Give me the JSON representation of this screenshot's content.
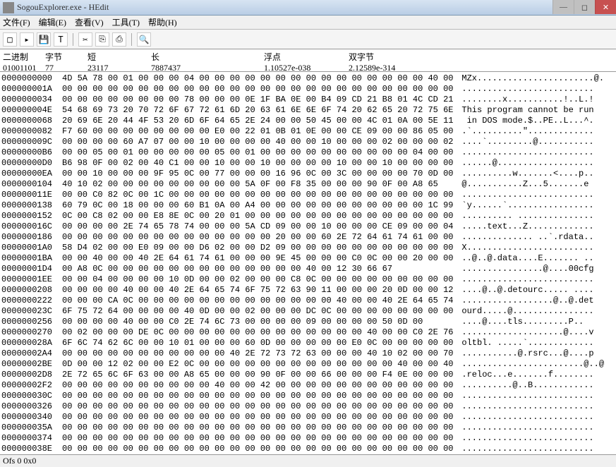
{
  "title": "SogouExplorer.exe - HEdit",
  "menu": {
    "file": "文件(F)",
    "edit": "编辑(E)",
    "view": "查看(V)",
    "tools": "工具(T)",
    "help": "帮助(H)"
  },
  "toolbar": {
    "new": "□",
    "open": "▸",
    "save": "💾",
    "text": "T",
    "cut": "✂",
    "copy": "⎘",
    "paste": "⎙",
    "find": "🔍"
  },
  "info": {
    "binary_label": "二进制",
    "binary_val": "01001101",
    "byte_label": "字节",
    "byte_val": "77",
    "short_label": "短",
    "short_val": "23117",
    "long_label": "长",
    "long_val": "7887437",
    "float_label": "浮点",
    "float_val": "1.10527e-038",
    "double_label": "双字节",
    "double_val": "2.12589e-314"
  },
  "status": "Ofs 0  0x0",
  "rows": [
    {
      "o": "0000000000",
      "h": "4D 5A 78 00 01 00 00 00 04 00 00 00 00 00 00 00 00 00 00 00 00 00 00 00 40 00",
      "a": "MZx.......................@."
    },
    {
      "o": "000000001A",
      "h": "00 00 00 00 00 00 00 00 00 00 00 00 00 00 00 00 00 00 00 00 00 00 00 00 00 00",
      "a": ".........................."
    },
    {
      "o": "0000000034",
      "h": "00 00 00 00 00 00 00 00 78 00 00 00 0E 1F BA 0E 00 B4 09 CD 21 B8 01 4C CD 21",
      "a": "........x...........!..L.!"
    },
    {
      "o": "000000004E",
      "h": "54 68 69 73 20 70 72 6F 67 72 61 6D 20 63 61 6E 6E 6F 74 20 62 65 20 72 75 6E",
      "a": "This program cannot be run"
    },
    {
      "o": "0000000068",
      "h": "20 69 6E 20 44 4F 53 20 6D 6F 64 65 2E 24 00 00 50 45 00 00 4C 01 0A 00 5E 11",
      "a": " in DOS mode.$..PE..L...^."
    },
    {
      "o": "0000000082",
      "h": "F7 60 00 00 00 00 00 00 00 00 E0 00 22 01 0B 01 0E 00 00 CE 09 00 00 86 05 00",
      "a": ".`..........\"............."
    },
    {
      "o": "000000009C",
      "h": "00 00 00 00 60 A7 07 00 00 10 00 00 00 00 40 00 00 10 00 00 00 02 00 00 00 02",
      "a": "....`.........@..........."
    },
    {
      "o": "00000000B6",
      "h": "00 00 05 00 01 00 00 00 00 00 05 00 01 00 00 00 00 00 00 00 00 00 00 04 00 00",
      "a": ".........................."
    },
    {
      "o": "00000000D0",
      "h": "B6 98 0F 00 02 00 40 C1 00 00 10 00 00 10 00 00 00 00 10 00 00 10 00 00 00 00",
      "a": "......@..................."
    },
    {
      "o": "00000000EA",
      "h": "00 00 10 00 00 00 9F 95 0C 00 77 00 00 00 16 96 0C 00 3C 00 00 00 00 70 0D 00",
      "a": "..........w.......<....p.."
    },
    {
      "o": "0000000104",
      "h": "40 10 02 00 00 00 00 00 00 00 00 00 5A 0F 00 F8 35 00 00 00 90 0F 00 A8 65",
      "a": "@...........Z...5.......e"
    },
    {
      "o": "000000011E",
      "h": "00 00 C0 82 0C 00 1C 00 00 00 00 00 00 00 00 00 00 00 00 00 00 00 00 00 00 00",
      "a": ".........................."
    },
    {
      "o": "0000000138",
      "h": "60 79 0C 00 18 00 00 00 60 B1 0A 00 A4 00 00 00 00 00 00 00 00 00 00 00 1C 99",
      "a": "`y......`................."
    },
    {
      "o": "0000000152",
      "h": "0C 00 C8 02 00 00 E8 8E 0C 00 20 01 00 00 00 00 00 00 00 00 00 00 00 00 00 00",
      "a": ".......... ..............."
    },
    {
      "o": "000000016C",
      "h": "00 00 00 00 2E 74 65 78 74 00 00 00 5A CD 09 00 00 10 00 00 00 CE 09 00 00 04",
      "a": ".....text...Z............."
    },
    {
      "o": "0000000186",
      "h": "00 00 00 00 00 00 00 00 00 00 00 00 00 00 20 00 00 60 2E 72 64 61 74 61 00 00",
      "a": ".............. ..`.rdata.."
    },
    {
      "o": "00000001A0",
      "h": "58 D4 02 00 00 E0 09 00 00 D6 02 00 00 D2 09 00 00 00 00 00 00 00 00 00 00 00",
      "a": "X........................."
    },
    {
      "o": "00000001BA",
      "h": "00 00 40 00 00 40 2E 64 61 74 61 00 00 00 9E 45 00 00 00 C0 0C 00 00 20 00 00",
      "a": "..@..@.data....E....... .."
    },
    {
      "o": "00000001D4",
      "h": "00 A8 0C 00 00 00 00 00 00 00 00 00 00 00 00 00 40 00 12 30 66 67",
      "a": "................@....00cfg"
    },
    {
      "o": "00000001EE",
      "h": "00 00 04 00 00 00 00 10 0D 00 00 02 00 00 00 C8 0C 00 00 00 00 00 00 00 00 00",
      "a": ".........................."
    },
    {
      "o": "0000000208",
      "h": "00 00 00 00 40 00 00 40 2E 64 65 74 6F 75 72 63 90 11 00 00 00 20 0D 00 00 12",
      "a": "....@..@.detourc..... ...."
    },
    {
      "o": "0000000222",
      "h": "00 00 00 CA 0C 00 00 00 00 00 00 00 00 00 00 00 00 00 40 00 00 40 2E 64 65 74",
      "a": "..................@..@.det"
    },
    {
      "o": "000000023C",
      "h": "6F 75 72 64 00 00 00 00 40 0D 00 00 02 00 00 00 DC 0C 00 00 00 00 00 00 00 00",
      "a": "ourd.....@................"
    },
    {
      "o": "0000000256",
      "h": "00 00 00 00 40 00 00 C0 2E 74 6C 73 00 00 00 00 09 00 00 00 00 50 0D 00",
      "a": "....@....tls.........P.."
    },
    {
      "o": "0000000270",
      "h": "00 02 00 00 00 DE 0C 00 00 00 00 00 00 00 00 00 00 00 00 00 40 00 00 C0 2E 76",
      "a": "....................@....v"
    },
    {
      "o": "000000028A",
      "h": "6F 6C 74 62 6C 00 00 10 01 00 00 00 60 0D 00 00 00 00 00 E0 0C 00 00 00 00 00",
      "a": "oltbl. .....`............."
    },
    {
      "o": "00000002A4",
      "h": "00 00 00 00 00 00 00 00 00 00 00 40 2E 72 73 72 63 00 00 00 40 10 02 00 00 70",
      "a": "...........@.rsrc...@....p"
    },
    {
      "o": "00000002BE",
      "h": "0D 00 00 12 02 00 00 E2 0C 00 00 00 00 00 00 00 00 00 00 00 00 00 40 00 00 40",
      "a": "........................@..@"
    },
    {
      "o": "00000002D8",
      "h": "2E 72 65 6C 6F 63 00 00 A8 65 00 00 00 90 0F 00 00 66 00 00 00 F4 0E 00 00 00",
      "a": ".reloc...e.......f........"
    },
    {
      "o": "00000002F2",
      "h": "00 00 00 00 00 00 00 00 00 00 40 00 00 42 00 00 00 00 00 00 00 00 00 00 00 00",
      "a": "..........@..B............"
    },
    {
      "o": "000000030C",
      "h": "00 00 00 00 00 00 00 00 00 00 00 00 00 00 00 00 00 00 00 00 00 00 00 00 00 00",
      "a": ".........................."
    },
    {
      "o": "0000000326",
      "h": "00 00 00 00 00 00 00 00 00 00 00 00 00 00 00 00 00 00 00 00 00 00 00 00 00 00",
      "a": ".........................."
    },
    {
      "o": "0000000340",
      "h": "00 00 00 00 00 00 00 00 00 00 00 00 00 00 00 00 00 00 00 00 00 00 00 00 00 00",
      "a": ".........................."
    },
    {
      "o": "000000035A",
      "h": "00 00 00 00 00 00 00 00 00 00 00 00 00 00 00 00 00 00 00 00 00 00 00 00 00 00",
      "a": ".........................."
    },
    {
      "o": "0000000374",
      "h": "00 00 00 00 00 00 00 00 00 00 00 00 00 00 00 00 00 00 00 00 00 00 00 00 00 00",
      "a": ".........................."
    },
    {
      "o": "000000038E",
      "h": "00 00 00 00 00 00 00 00 00 00 00 00 00 00 00 00 00 00 00 00 00 00 00 00 00 00",
      "a": ".........................."
    }
  ]
}
